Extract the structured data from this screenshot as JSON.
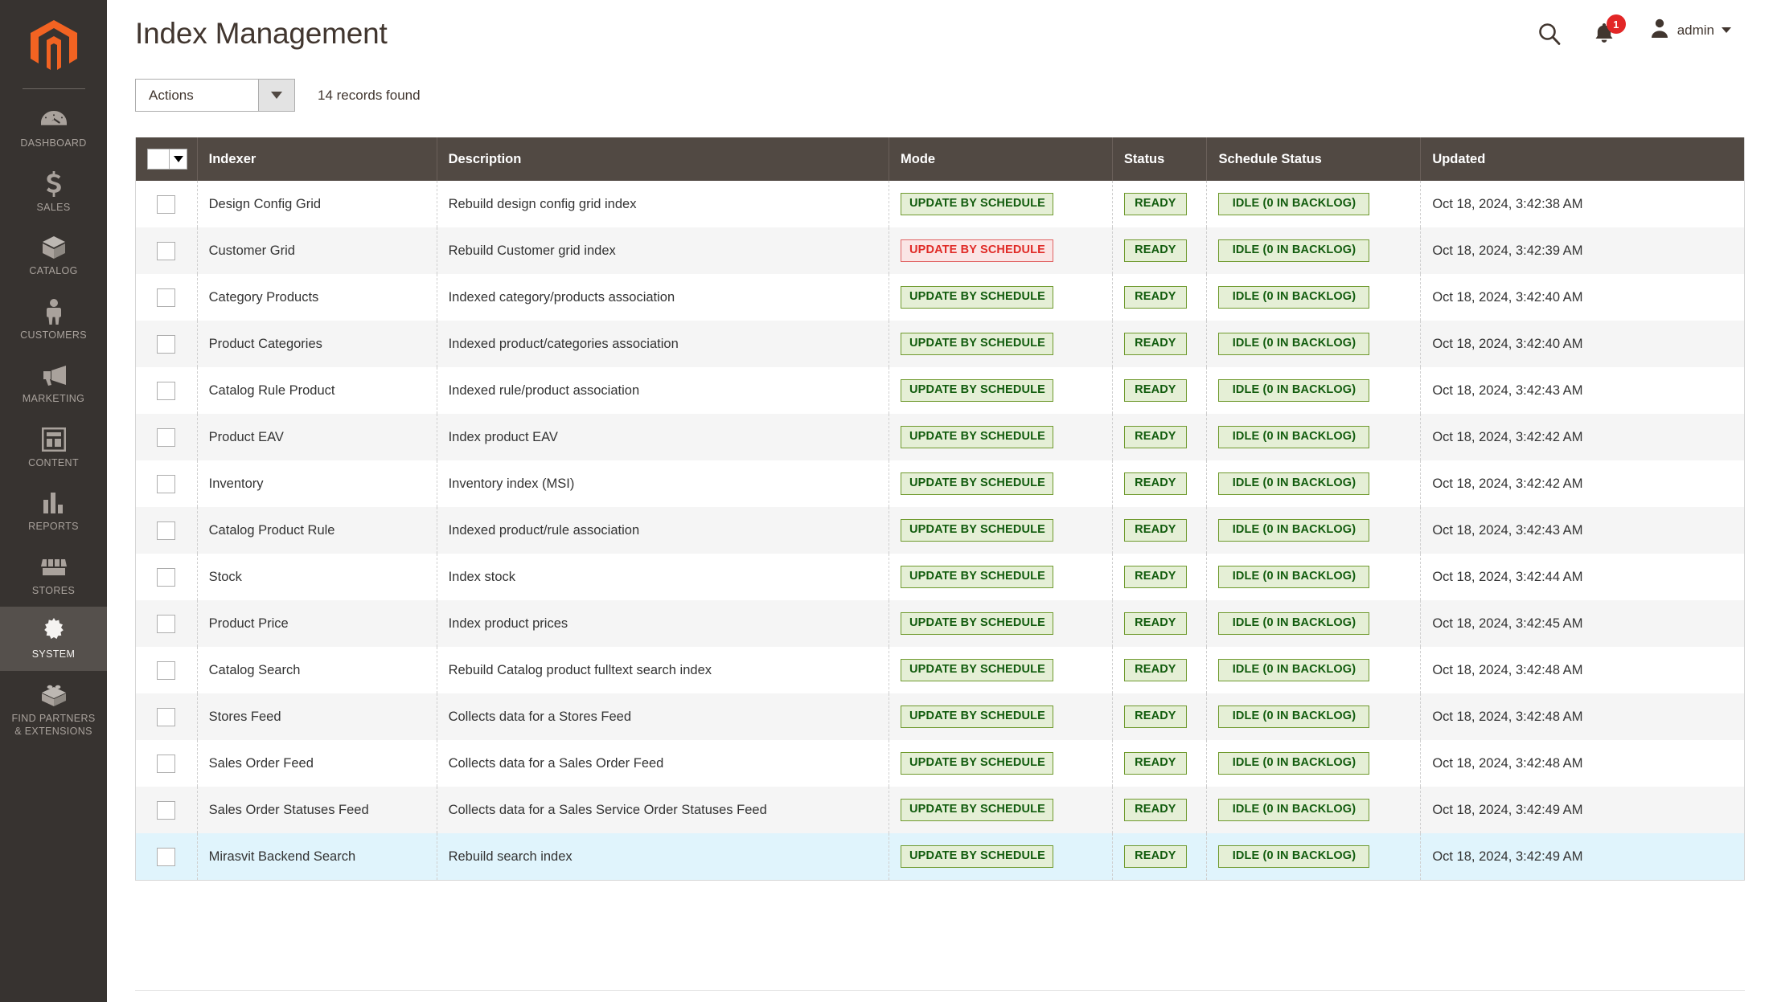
{
  "header": {
    "page_title": "Index Management",
    "search_icon": "search-icon",
    "notifications": {
      "icon": "bell-icon",
      "count": "1"
    },
    "user": {
      "avatar_icon": "user-avatar-icon",
      "name": "admin",
      "caret": "chevron-down-icon"
    }
  },
  "sidebar": {
    "logo": "magento-logo",
    "items": [
      {
        "label": "Dashboard",
        "icon": "dashboard-gauge-icon",
        "active": false
      },
      {
        "label": "Sales",
        "icon": "dollar-sign-icon",
        "active": false
      },
      {
        "label": "Catalog",
        "icon": "box-icon",
        "active": false
      },
      {
        "label": "Customers",
        "icon": "person-icon",
        "active": false
      },
      {
        "label": "Marketing",
        "icon": "megaphone-icon",
        "active": false
      },
      {
        "label": "Content",
        "icon": "layout-page-icon",
        "active": false
      },
      {
        "label": "Reports",
        "icon": "bar-chart-icon",
        "active": false
      },
      {
        "label": "Stores",
        "icon": "storefront-icon",
        "active": false
      },
      {
        "label": "System",
        "icon": "gear-icon",
        "active": true
      },
      {
        "label": "Find Partners\n& Extensions",
        "icon": "lego-brick-icon",
        "active": false
      }
    ]
  },
  "toolbar": {
    "actions_label": "Actions",
    "actions_caret": "chevron-down-icon",
    "records_found": "14 records found"
  },
  "grid": {
    "select_all_control": "mass-select-checkbox-dropdown",
    "columns": [
      "Indexer",
      "Description",
      "Mode",
      "Status",
      "Schedule Status",
      "Updated"
    ],
    "rows": [
      {
        "indexer": "Design Config Grid",
        "description": "Rebuild design config grid index",
        "mode": "UPDATE BY SCHEDULE",
        "mode_state": "green",
        "status": "READY",
        "schedule_status": "IDLE (0 IN BACKLOG)",
        "updated": "Oct 18, 2024, 3:42:38 AM",
        "highlight": false
      },
      {
        "indexer": "Customer Grid",
        "description": "Rebuild Customer grid index",
        "mode": "UPDATE BY SCHEDULE",
        "mode_state": "red",
        "status": "READY",
        "schedule_status": "IDLE (0 IN BACKLOG)",
        "updated": "Oct 18, 2024, 3:42:39 AM",
        "highlight": false
      },
      {
        "indexer": "Category Products",
        "description": "Indexed category/products association",
        "mode": "UPDATE BY SCHEDULE",
        "mode_state": "green",
        "status": "READY",
        "schedule_status": "IDLE (0 IN BACKLOG)",
        "updated": "Oct 18, 2024, 3:42:40 AM",
        "highlight": false
      },
      {
        "indexer": "Product Categories",
        "description": "Indexed product/categories association",
        "mode": "UPDATE BY SCHEDULE",
        "mode_state": "green",
        "status": "READY",
        "schedule_status": "IDLE (0 IN BACKLOG)",
        "updated": "Oct 18, 2024, 3:42:40 AM",
        "highlight": false
      },
      {
        "indexer": "Catalog Rule Product",
        "description": "Indexed rule/product association",
        "mode": "UPDATE BY SCHEDULE",
        "mode_state": "green",
        "status": "READY",
        "schedule_status": "IDLE (0 IN BACKLOG)",
        "updated": "Oct 18, 2024, 3:42:43 AM",
        "highlight": false
      },
      {
        "indexer": "Product EAV",
        "description": "Index product EAV",
        "mode": "UPDATE BY SCHEDULE",
        "mode_state": "green",
        "status": "READY",
        "schedule_status": "IDLE (0 IN BACKLOG)",
        "updated": "Oct 18, 2024, 3:42:42 AM",
        "highlight": false
      },
      {
        "indexer": "Inventory",
        "description": "Inventory index (MSI)",
        "mode": "UPDATE BY SCHEDULE",
        "mode_state": "green",
        "status": "READY",
        "schedule_status": "IDLE (0 IN BACKLOG)",
        "updated": "Oct 18, 2024, 3:42:42 AM",
        "highlight": false
      },
      {
        "indexer": "Catalog Product Rule",
        "description": "Indexed product/rule association",
        "mode": "UPDATE BY SCHEDULE",
        "mode_state": "green",
        "status": "READY",
        "schedule_status": "IDLE (0 IN BACKLOG)",
        "updated": "Oct 18, 2024, 3:42:43 AM",
        "highlight": false
      },
      {
        "indexer": "Stock",
        "description": "Index stock",
        "mode": "UPDATE BY SCHEDULE",
        "mode_state": "green",
        "status": "READY",
        "schedule_status": "IDLE (0 IN BACKLOG)",
        "updated": "Oct 18, 2024, 3:42:44 AM",
        "highlight": false
      },
      {
        "indexer": "Product Price",
        "description": "Index product prices",
        "mode": "UPDATE BY SCHEDULE",
        "mode_state": "green",
        "status": "READY",
        "schedule_status": "IDLE (0 IN BACKLOG)",
        "updated": "Oct 18, 2024, 3:42:45 AM",
        "highlight": false
      },
      {
        "indexer": "Catalog Search",
        "description": "Rebuild Catalog product fulltext search index",
        "mode": "UPDATE BY SCHEDULE",
        "mode_state": "green",
        "status": "READY",
        "schedule_status": "IDLE (0 IN BACKLOG)",
        "updated": "Oct 18, 2024, 3:42:48 AM",
        "highlight": false
      },
      {
        "indexer": "Stores Feed",
        "description": "Collects data for a Stores Feed",
        "mode": "UPDATE BY SCHEDULE",
        "mode_state": "green",
        "status": "READY",
        "schedule_status": "IDLE (0 IN BACKLOG)",
        "updated": "Oct 18, 2024, 3:42:48 AM",
        "highlight": false
      },
      {
        "indexer": "Sales Order Feed",
        "description": "Collects data for a Sales Order Feed",
        "mode": "UPDATE BY SCHEDULE",
        "mode_state": "green",
        "status": "READY",
        "schedule_status": "IDLE (0 IN BACKLOG)",
        "updated": "Oct 18, 2024, 3:42:48 AM",
        "highlight": false
      },
      {
        "indexer": "Sales Order Statuses Feed",
        "description": "Collects data for a Sales Service Order Statuses Feed",
        "mode": "UPDATE BY SCHEDULE",
        "mode_state": "green",
        "status": "READY",
        "schedule_status": "IDLE (0 IN BACKLOG)",
        "updated": "Oct 18, 2024, 3:42:49 AM",
        "highlight": false
      },
      {
        "indexer": "Mirasvit Backend Search",
        "description": "Rebuild search index",
        "mode": "UPDATE BY SCHEDULE",
        "mode_state": "green",
        "status": "READY",
        "schedule_status": "IDLE (0 IN BACKLOG)",
        "updated": "Oct 18, 2024, 3:42:49 AM",
        "highlight": true
      }
    ]
  },
  "colors": {
    "sidebar_bg": "#373330",
    "sidebar_active_bg": "#55504c",
    "brand_orange": "#f26322",
    "table_header_bg": "#514943",
    "badge_green_bg": "#e5efd6",
    "badge_green_border": "#6f9a2e",
    "badge_green_text": "#125c0e",
    "badge_red_bg": "#fae5e5",
    "badge_red_border": "#e06363",
    "badge_red_text": "#e02b27",
    "row_highlight": "#e0f4fc",
    "notification_badge": "#e22626"
  }
}
